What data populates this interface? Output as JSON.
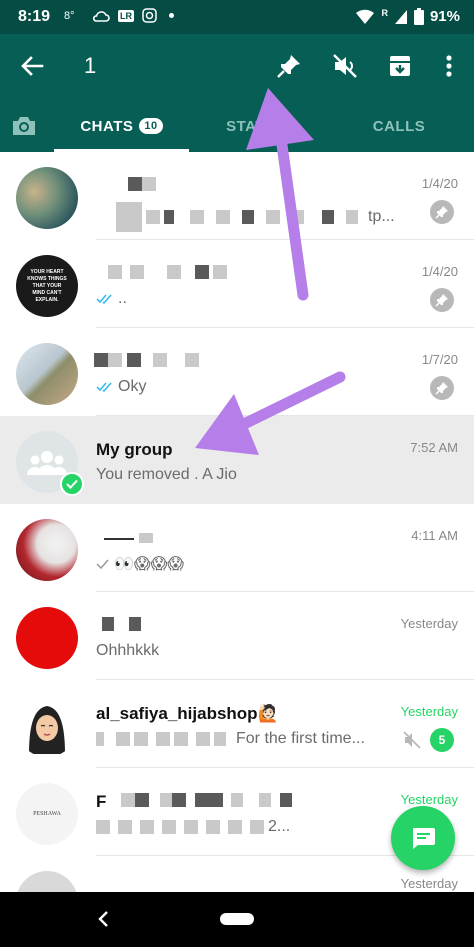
{
  "status_bar": {
    "time": "8:19",
    "temperature": "8°",
    "lr_label": "LR",
    "battery": "91%",
    "signal_label": "R"
  },
  "toolbar": {
    "selected_count": "1"
  },
  "tabs": [
    {
      "label": "CHATS",
      "badge": "10"
    },
    {
      "label": "STATUS"
    },
    {
      "label": "CALLS"
    }
  ],
  "chats": [
    {
      "name": "",
      "message": "tp...",
      "time": "1/4/20",
      "pinned": true
    },
    {
      "name": "",
      "message": "..",
      "time": "1/4/20",
      "pinned": true,
      "read_ticks": true,
      "avatar_text": "YOUR HEART KNOWS THINGS THAT YOUR MIND CAN'T EXPLAIN."
    },
    {
      "name": "",
      "message": "Oky",
      "time": "1/7/20",
      "pinned": true,
      "read_ticks": true
    },
    {
      "name": "My group",
      "message": "You removed . A Jio",
      "time": "7:52 AM",
      "selected": true
    },
    {
      "name": "",
      "message": "👀😱😱😱",
      "time": "4:11 AM"
    },
    {
      "name": "",
      "message": "Ohhhkkk",
      "time": "Yesterday"
    },
    {
      "name": "al_safiya_hijabshop🙋🏻",
      "message": "For the first time...",
      "time": "Yesterday",
      "unread": "5",
      "muted": true
    },
    {
      "name": "F",
      "message": "2...",
      "time": "Yesterday",
      "avatar_text": "PESHAWA"
    },
    {
      "name": "",
      "message": "",
      "time": "Yesterday"
    }
  ],
  "colors": {
    "header": "#075e54",
    "status": "#054d44",
    "accent": "#25d366",
    "arrow": "#b57ee8"
  }
}
